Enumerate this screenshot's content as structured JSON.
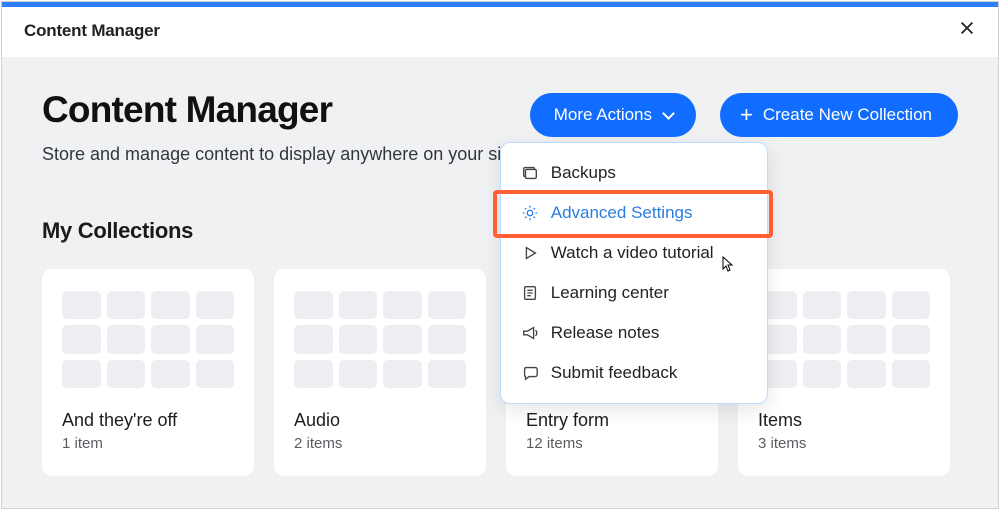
{
  "topbar": {
    "title": "Content Manager"
  },
  "header": {
    "title": "Content Manager",
    "desc": "Store and manage content to display anywhere on your site.",
    "more_label": "More Actions",
    "create_label": "Create New Collection"
  },
  "dropdown": {
    "items": [
      {
        "label": "Backups"
      },
      {
        "label": "Advanced Settings"
      },
      {
        "label": "Watch a video tutorial"
      },
      {
        "label": "Learning center"
      },
      {
        "label": "Release notes"
      },
      {
        "label": "Submit feedback"
      }
    ]
  },
  "collections": {
    "section_title": "My Collections",
    "items": [
      {
        "name": "And they're off",
        "count": "1 item"
      },
      {
        "name": "Audio",
        "count": "2 items"
      },
      {
        "name": "Entry form",
        "count": "12 items"
      },
      {
        "name": "Items",
        "count": "3 items"
      }
    ]
  }
}
